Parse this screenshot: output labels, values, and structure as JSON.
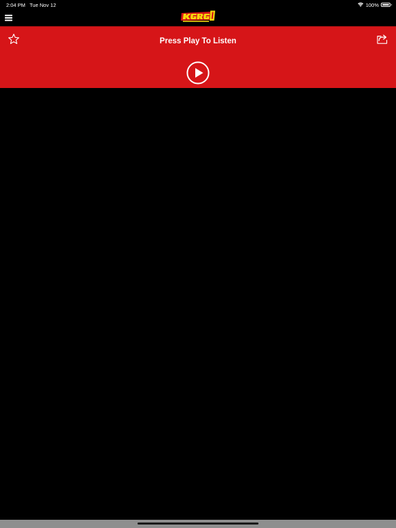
{
  "status_bar": {
    "time": "2:04 PM",
    "date": "Tue Nov 12",
    "battery_label": "100%",
    "battery_level": 1.0,
    "wifi_icon": "wifi-icon",
    "battery_icon": "battery-icon"
  },
  "nav": {
    "menu_icon": "hamburger-menu-icon",
    "logo_icon": "kgrg-logo"
  },
  "player": {
    "title": "Press Play To Listen",
    "favorite_icon": "star-icon",
    "share_icon": "share-icon",
    "play_icon": "play-circle-icon"
  },
  "colors": {
    "background": "#000000",
    "header_red": "#d61518",
    "logo_yellow": "#f6d80c",
    "text": "#ffffff",
    "bottom_bar": "#8e8e8e"
  }
}
